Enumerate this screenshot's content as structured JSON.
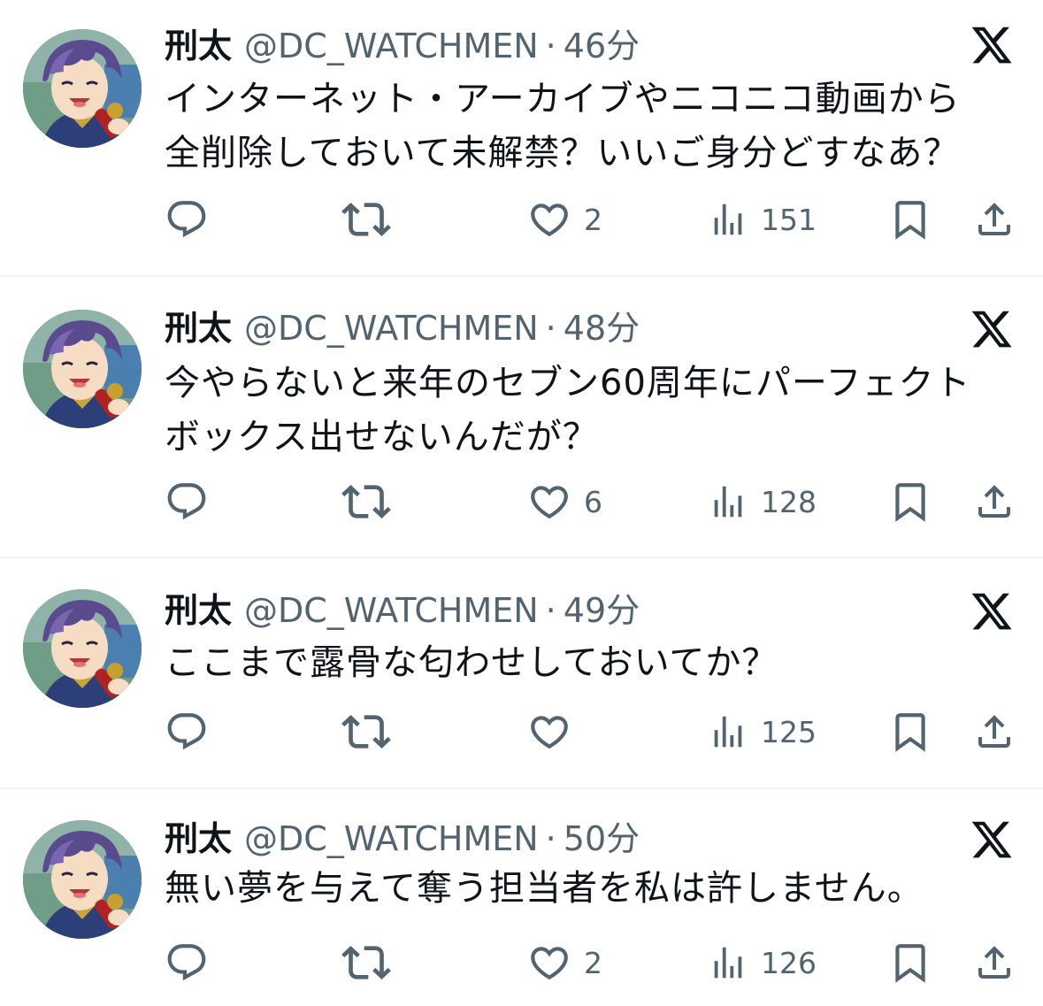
{
  "tweets": [
    {
      "display_name": "刑太",
      "handle": "@DC_WATCHMEN",
      "separator": "·",
      "time": "46分",
      "text": "インターネット・アーカイブやニコニコ動画から\n全削除しておいて未解禁？いいご身分どすなあ？",
      "likes": "2",
      "views": "151",
      "avatar_icon": "anime-character-avatar",
      "platform_icon": "x-logo-icon"
    },
    {
      "display_name": "刑太",
      "handle": "@DC_WATCHMEN",
      "separator": "·",
      "time": "48分",
      "text": "今やらないと来年のセブン60周年にパーフェクト\nボックス出せないんだが？",
      "likes": "6",
      "views": "128",
      "avatar_icon": "anime-character-avatar",
      "platform_icon": "x-logo-icon"
    },
    {
      "display_name": "刑太",
      "handle": "@DC_WATCHMEN",
      "separator": "·",
      "time": "49分",
      "text": "ここまで露骨な匂わせしておいてか？",
      "likes": "",
      "views": "125",
      "avatar_icon": "anime-character-avatar",
      "platform_icon": "x-logo-icon"
    },
    {
      "display_name": "刑太",
      "handle": "@DC_WATCHMEN",
      "separator": "·",
      "time": "50分",
      "text": "無い夢を与えて奪う担当者を私は許しません。",
      "likes": "2",
      "views": "126",
      "avatar_icon": "anime-character-avatar",
      "platform_icon": "x-logo-icon"
    }
  ],
  "colors": {
    "text_primary": "#0f1419",
    "text_secondary": "#536471",
    "divider": "#eff3f4",
    "background": "#ffffff"
  }
}
